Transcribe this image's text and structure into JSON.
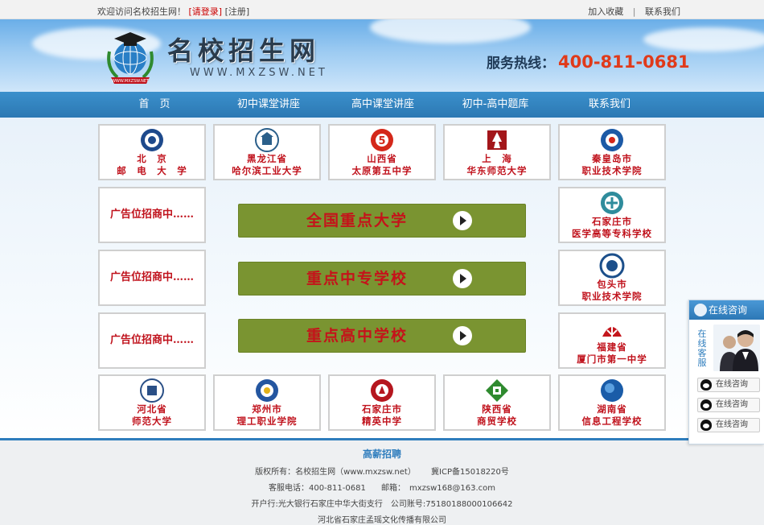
{
  "topbar": {
    "welcome": "欢迎访问名校招生网！",
    "login": "[请登录]",
    "register": "[注册]",
    "favorite": "加入收藏",
    "divider": "|",
    "contact": "联系我们"
  },
  "header": {
    "title": "名校招生网",
    "url": "WWW.MXZSW.NET",
    "logo_text": "WWW.MXZSW.NET",
    "hotline_label": "服务热线：",
    "hotline_number": "400-811-0681"
  },
  "nav": {
    "items": [
      "首　页",
      "初中课堂讲座",
      "高中课堂讲座",
      "初中-高中题库",
      "联系我们"
    ]
  },
  "schools": {
    "row1": [
      {
        "line1": "北　京",
        "line2": "邮　电　大　学",
        "color": "#1e4a8c"
      },
      {
        "line1": "黑龙江省",
        "line2": "哈尔滨工业大学",
        "color": "#2b5f8a"
      },
      {
        "line1": "山西省",
        "line2": "太原第五中学",
        "color": "#d4281a"
      },
      {
        "line1": "上　海",
        "line2": "华东师范大学",
        "color": "#a3161a"
      },
      {
        "line1": "秦皇岛市",
        "line2": "职业技术学院",
        "color": "#1c5aa6"
      }
    ],
    "right_col": [
      {
        "line1": "石家庄市",
        "line2": "医学高等专科学校",
        "color": "#2f8c9c"
      },
      {
        "line1": "包头市",
        "line2": "职业技术学院",
        "color": "#1c4f8a"
      },
      {
        "line1": "福建省",
        "line2": "厦门市第一中学",
        "color": "#c4161c"
      }
    ],
    "row5": [
      {
        "line1": "河北省",
        "line2": "师范大学",
        "color": "#2a4f86"
      },
      {
        "line1": "郑州市",
        "line2": "理工职业学院",
        "color": "#2456a0"
      },
      {
        "line1": "石家庄市",
        "line2": "精英中学",
        "color": "#b5161e"
      },
      {
        "line1": "陕西省",
        "line2": "商贸学校",
        "color": "#2f8a2f"
      },
      {
        "line1": "湖南省",
        "line2": "信息工程学校",
        "color": "#1a5ca8"
      }
    ]
  },
  "ads": [
    "广告位招商中……",
    "广告位招商中……",
    "广告位招商中……"
  ],
  "categories": [
    "全国重点大学",
    "重点中专学校",
    "重点高中学校"
  ],
  "consult": {
    "title": "在线咨询",
    "vertical": "在线客服",
    "buttons": [
      "在线咨询",
      "在线咨询",
      "在线咨询"
    ]
  },
  "footer": {
    "heading": "高薪招聘",
    "copyright": "版权所有：名校招生网（www.mxzsw.net）",
    "icp": "冀ICP备15018220号",
    "phone": "客服电话：400-811-0681",
    "email": "邮箱：　mxzsw168@163.com",
    "bank": "开户行:光大银行石家庄中华大街支行　公司账号:75180188000106642",
    "company": "河北省石家庄孟瑶文化传播有限公司"
  }
}
